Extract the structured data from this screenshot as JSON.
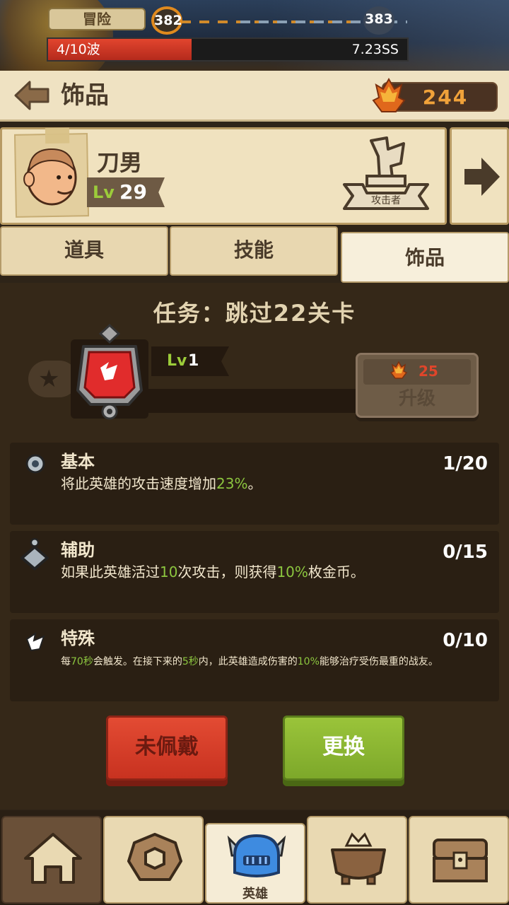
{
  "top_bar": {
    "mode_label": "冒险",
    "current_stage": "382",
    "next_stage": "383",
    "wave_label": "4/10波",
    "wave_progress": 0.4,
    "time_label": "7.23SS"
  },
  "header": {
    "title": "饰品",
    "gem_count": "244"
  },
  "hero": {
    "name": "刀男",
    "level_prefix": "Lv",
    "level": "29",
    "role": "攻击者"
  },
  "tabs": [
    {
      "label": "道具",
      "active": false
    },
    {
      "label": "技能",
      "active": false
    },
    {
      "label": "饰品",
      "active": true
    }
  ],
  "accessory": {
    "mission": "任务：跳过22关卡",
    "level_prefix": "Lv",
    "level": "1",
    "upgrade_cost": "25",
    "upgrade_label": "升级"
  },
  "stats": [
    {
      "title": "基本",
      "count": "1/20",
      "desc_parts": [
        "将此英雄的攻击速度增加",
        "23%",
        "。"
      ]
    },
    {
      "title": "辅助",
      "count": "0/15",
      "desc_parts": [
        "如果此英雄活过",
        "10",
        "次攻击，则获得",
        "10%",
        "枚金币。"
      ]
    },
    {
      "title": "特殊",
      "count": "0/10",
      "desc_parts": [
        "每",
        "70秒",
        "会触发。在接下来的",
        "5秒",
        "内，此英雄造成伤害的",
        "10%",
        "能够治疗受伤最重的战友。"
      ]
    }
  ],
  "actions": {
    "unequip_label": "未佩戴",
    "replace_label": "更换"
  },
  "bottom_nav": {
    "active_label": "英雄"
  },
  "colors": {
    "accent_green": "#8cc63f",
    "gem_orange": "#f0a23a",
    "panel_bg": "#352818",
    "red_button": "#e34b33",
    "green_button": "#9ac43a"
  }
}
